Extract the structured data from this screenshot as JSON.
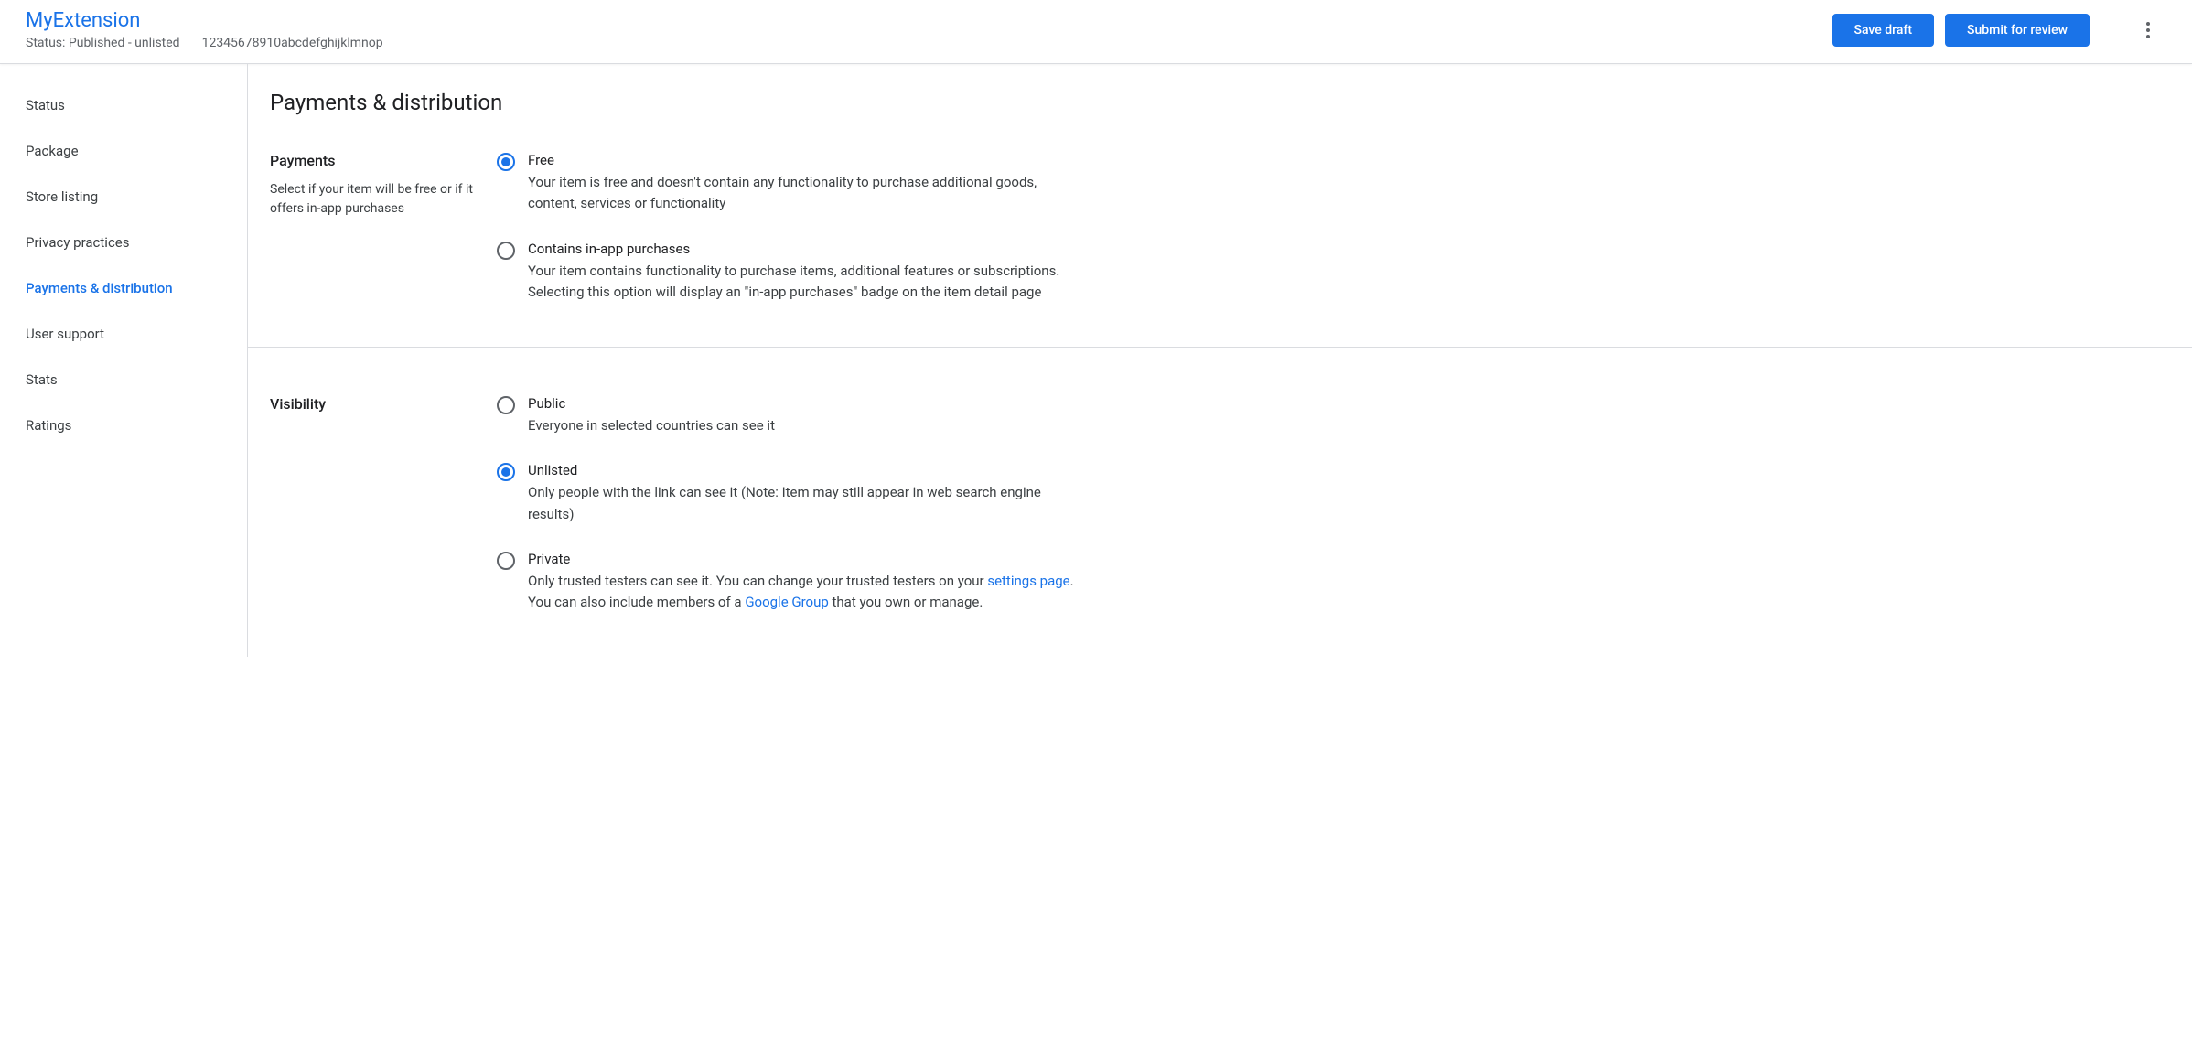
{
  "header": {
    "extension_name": "MyExtension",
    "status_text": "Status: Published - unlisted",
    "item_id": "12345678910abcdefghijklmnop",
    "save_draft_label": "Save draft",
    "submit_label": "Submit for review"
  },
  "sidebar": {
    "items": [
      {
        "label": "Status",
        "active": false
      },
      {
        "label": "Package",
        "active": false
      },
      {
        "label": "Store listing",
        "active": false
      },
      {
        "label": "Privacy practices",
        "active": false
      },
      {
        "label": "Payments & distribution",
        "active": true
      },
      {
        "label": "User support",
        "active": false
      },
      {
        "label": "Stats",
        "active": false
      },
      {
        "label": "Ratings",
        "active": false
      }
    ]
  },
  "main": {
    "page_title": "Payments & distribution",
    "payments_section": {
      "title": "Payments",
      "desc": "Select if your item will be free or if it offers in-app purchases",
      "options": [
        {
          "label": "Free",
          "desc": "Your item is free and doesn't contain any functionality to purchase additional goods, content, services or functionality",
          "selected": true
        },
        {
          "label": "Contains in-app purchases",
          "desc": "Your item contains functionality to purchase items, additional features or subscriptions. Selecting this option will display an \"in-app purchases\" badge on the item detail page",
          "selected": false
        }
      ]
    },
    "visibility_section": {
      "title": "Visibility",
      "options": [
        {
          "label": "Public",
          "desc": "Everyone in selected countries can see it",
          "selected": false
        },
        {
          "label": "Unlisted",
          "desc": "Only people with the link can see it (Note: Item may still appear in web search engine results)",
          "selected": true
        },
        {
          "label": "Private",
          "desc_pre": "Only trusted testers can see it. You can change your trusted testers on your ",
          "link1": "settings page",
          "desc_mid": ".",
          "desc_line2_pre": "You can also include members of a ",
          "link2": "Google Group",
          "desc_line2_post": " that you own or manage.",
          "selected": false
        }
      ]
    }
  }
}
